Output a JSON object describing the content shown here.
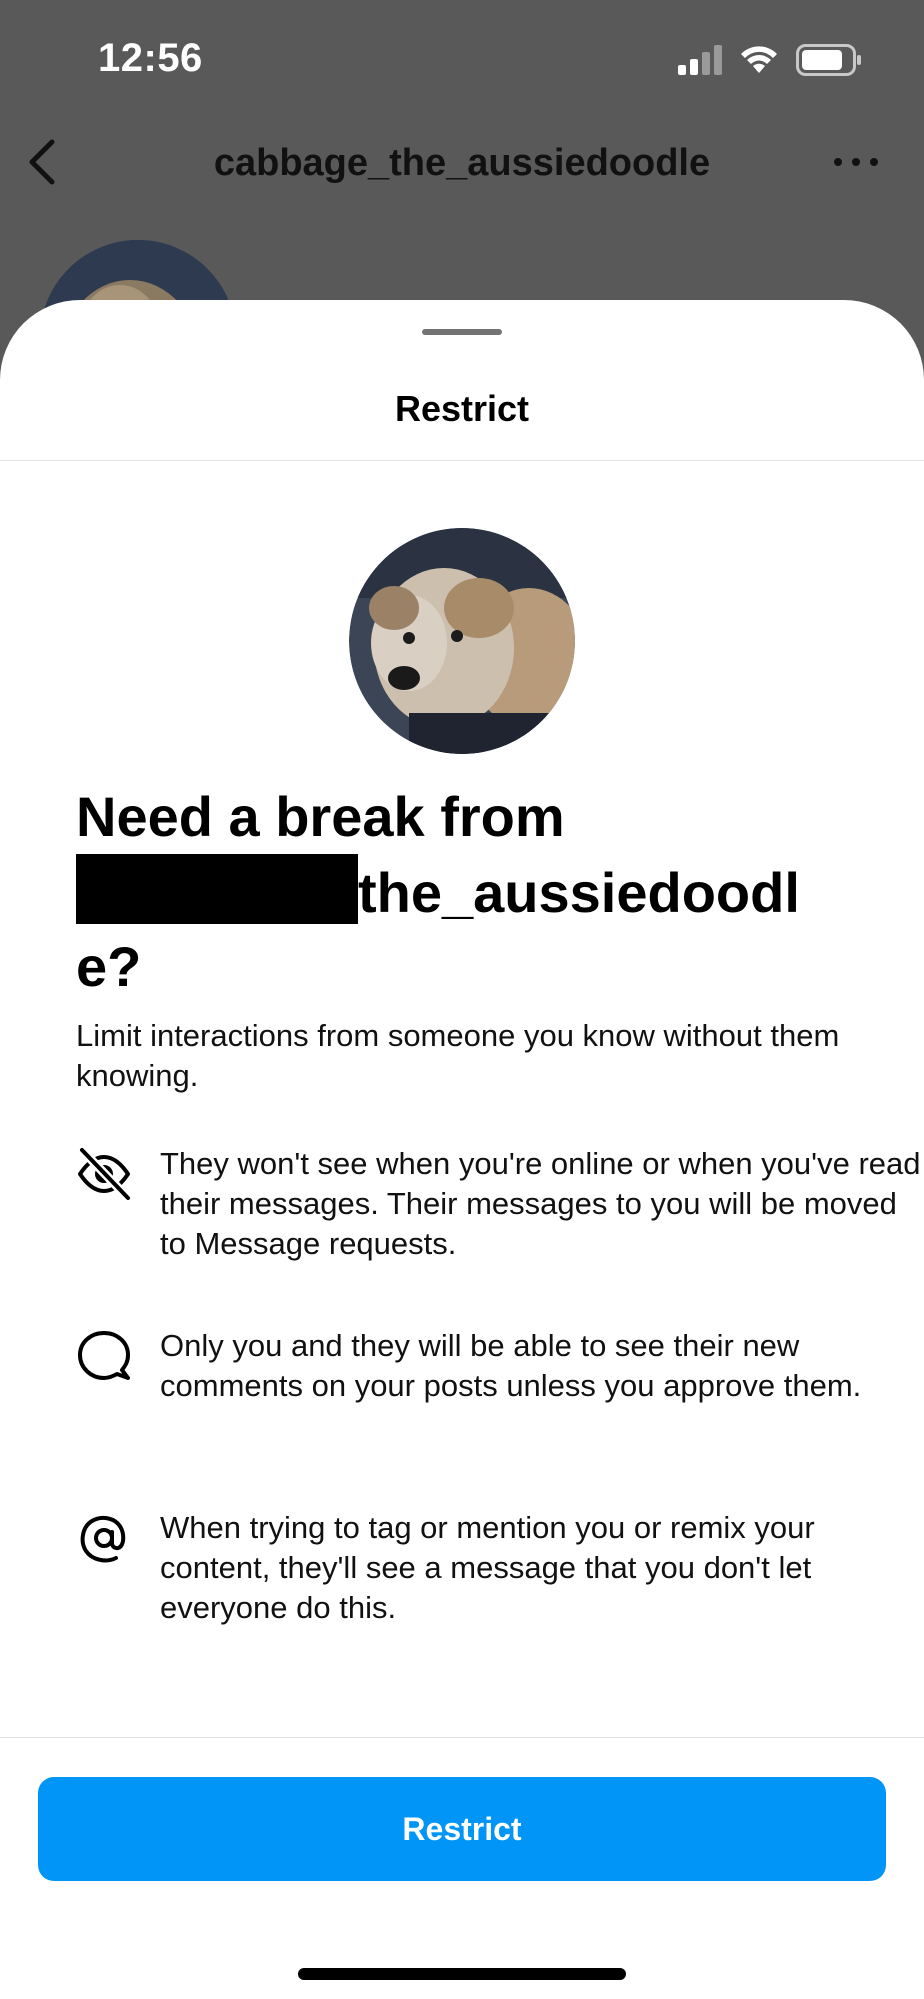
{
  "status_bar": {
    "time": "12:56"
  },
  "nav": {
    "title": "cabbage_the_aussiedoodle"
  },
  "sheet": {
    "title": "Restrict",
    "heading_line1": "Need a break from",
    "heading_visible_part": "the_aussiedoodl",
    "heading_end": "e?",
    "description": "Limit interactions from someone you know without them knowing.",
    "items": [
      {
        "icon": "eye-off-icon",
        "text": "They won't see when you're online or when you've read their messages. Their messages to you will be moved to Message requests."
      },
      {
        "icon": "comment-icon",
        "text": "Only you and they will be able to see their new comments on your posts unless you approve them."
      },
      {
        "icon": "at-mention-icon",
        "text": "When trying to tag or mention you or remix your content, they'll see a message that you don't let everyone do this."
      }
    ],
    "button_label": "Restrict"
  },
  "colors": {
    "accent": "#0095f6",
    "overlay": "#595959"
  }
}
